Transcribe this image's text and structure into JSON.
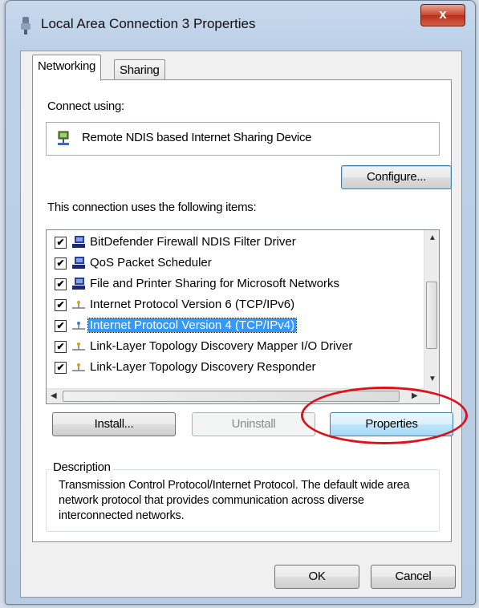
{
  "window": {
    "title": "Local Area Connection 3 Properties",
    "close_label": "x"
  },
  "tabs": [
    {
      "label": "Networking",
      "active": true
    },
    {
      "label": "Sharing",
      "active": false
    }
  ],
  "connect_using": {
    "label": "Connect using:",
    "adapter": "Remote NDIS based Internet Sharing Device",
    "adapter_icon": "network-adapter-icon"
  },
  "configure_label": "Configure...",
  "items_label": "This connection uses the following items:",
  "items": [
    {
      "label": "BitDefender Firewall NDIS Filter Driver",
      "checked": true,
      "icon": "network-client-icon",
      "selected": false
    },
    {
      "label": "QoS Packet Scheduler",
      "checked": true,
      "icon": "network-client-icon",
      "selected": false
    },
    {
      "label": "File and Printer Sharing for Microsoft Networks",
      "checked": true,
      "icon": "network-client-icon",
      "selected": false
    },
    {
      "label": "Internet Protocol Version 6 (TCP/IPv6)",
      "checked": true,
      "icon": "protocol-icon",
      "selected": false
    },
    {
      "label": "Internet Protocol Version 4 (TCP/IPv4)",
      "checked": true,
      "icon": "protocol-icon",
      "selected": true
    },
    {
      "label": "Link-Layer Topology Discovery Mapper I/O Driver",
      "checked": true,
      "icon": "protocol-icon",
      "selected": false
    },
    {
      "label": "Link-Layer Topology Discovery Responder",
      "checked": true,
      "icon": "protocol-icon",
      "selected": false
    }
  ],
  "buttons": {
    "install": "Install...",
    "uninstall": "Uninstall",
    "properties": "Properties",
    "ok": "OK",
    "cancel": "Cancel"
  },
  "description": {
    "title": "Description",
    "text": "Transmission Control Protocol/Internet Protocol. The default wide area network protocol that provides communication across diverse interconnected networks."
  },
  "colors": {
    "selection": "#3399ff",
    "highlight_circle": "#d8151f",
    "close_button": "#c9452d"
  }
}
